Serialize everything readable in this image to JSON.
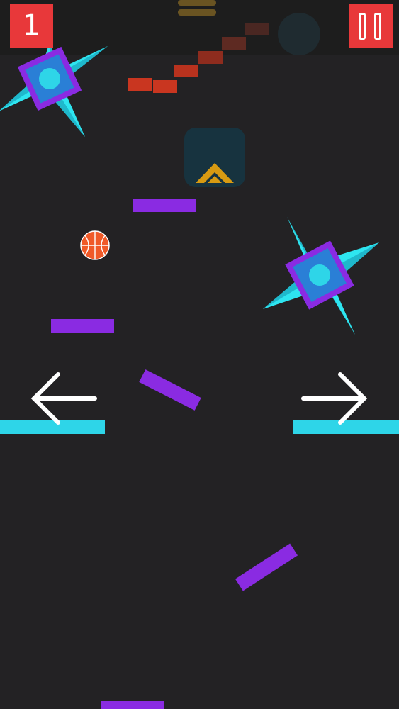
{
  "hud": {
    "score": "1",
    "pause_icon": "pause-icon"
  },
  "controls": {
    "left_icon": "arrow-left-icon",
    "right_icon": "arrow-right-icon"
  },
  "colors": {
    "background": "#232224",
    "hud_red": "#e8383a",
    "platform_purple": "#8a2be2",
    "ledge_cyan": "#2ed5e8",
    "shuriken_cyan": "#2ee5f0",
    "shuriken_frame": "#8a2be2",
    "ball_orange": "#f05a28",
    "boost_gold": "#e0a000",
    "brick_red": "#d23a22"
  }
}
